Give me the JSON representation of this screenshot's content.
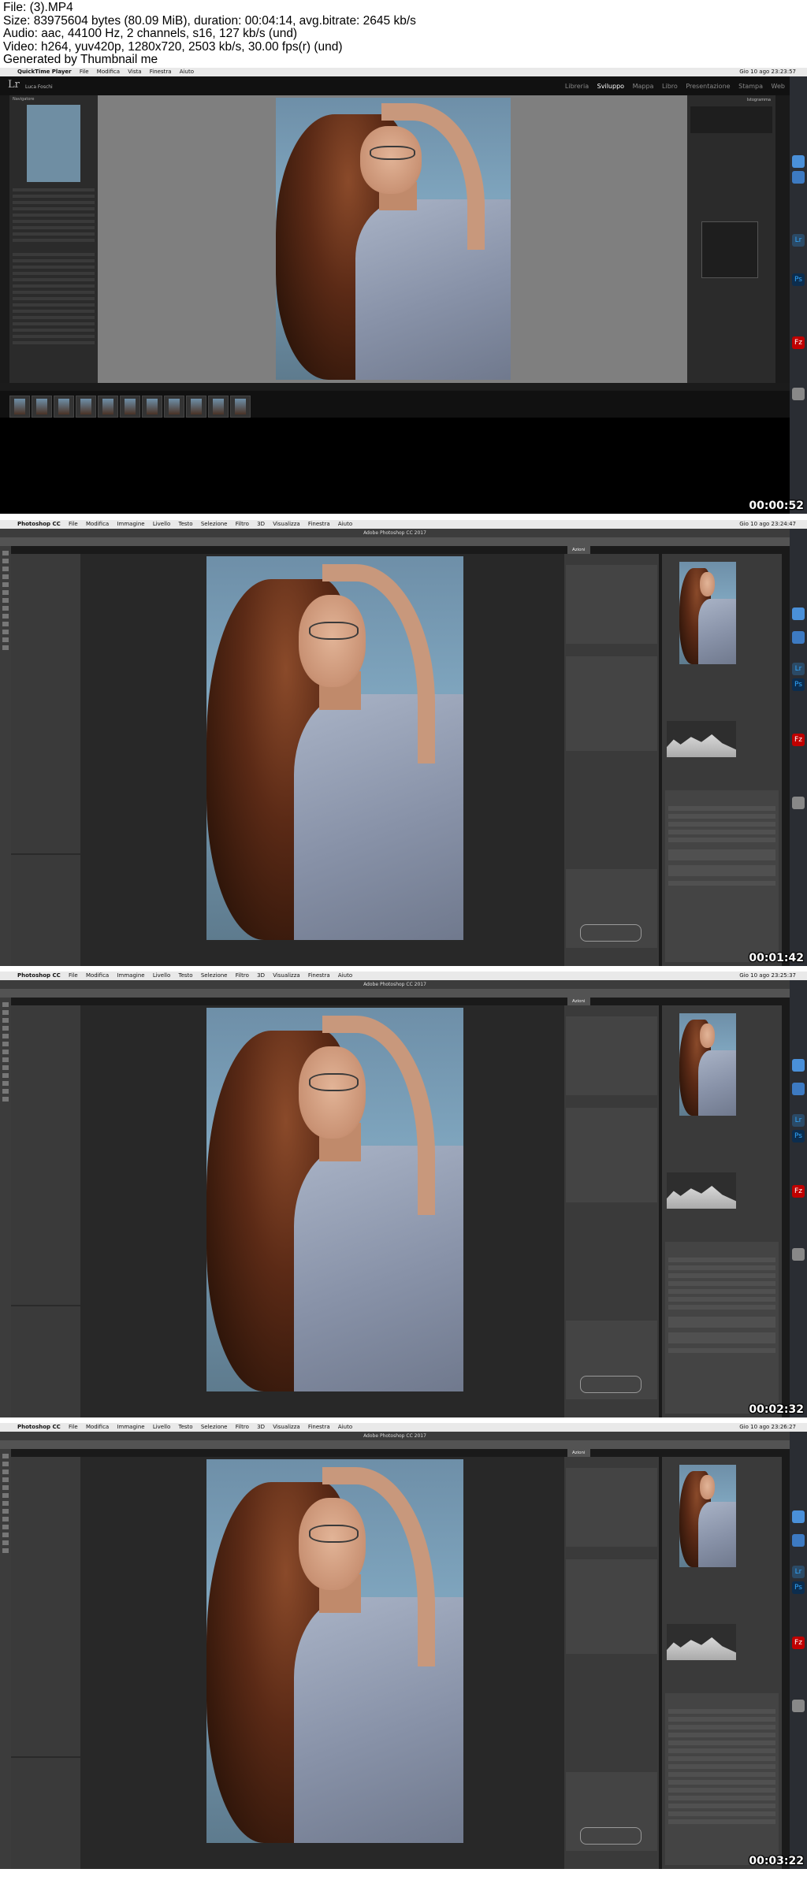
{
  "header": {
    "line1": "File:  (3).MP4",
    "line2": "Size: 83975604 bytes (80.09 MiB), duration: 00:04:14, avg.bitrate: 2645 kb/s",
    "line3": "Audio: aac, 44100 Hz, 2 channels, s16, 127 kb/s (und)",
    "line4": "Video: h264, yuv420p, 1280x720, 2503 kb/s, 30.00 fps(r) (und)",
    "line5": "Generated by Thumbnail me"
  },
  "frames": [
    {
      "app": "QuickTime Player",
      "menu": [
        "File",
        "Modifica",
        "Vista",
        "Finestra",
        "Aiuto"
      ],
      "clock": "Gio 10 ago 23:23:57",
      "timestamp": "00:00:52",
      "lightroom": {
        "logo": "Lr",
        "user": "Luca Foschi",
        "modules": [
          "Libreria",
          "Sviluppo",
          "Mappa",
          "Libro",
          "Presentazione",
          "Stampa",
          "Web"
        ],
        "active_module": "Sviluppo",
        "navigator": "Navigatore",
        "histogram_label": "Istogramma"
      }
    },
    {
      "app": "Photoshop CC",
      "menu": [
        "File",
        "Modifica",
        "Immagine",
        "Livello",
        "Testo",
        "Selezione",
        "Filtro",
        "3D",
        "Visualizza",
        "Finestra",
        "Aiuto"
      ],
      "clock": "Gio 10 ago 23:24:47",
      "window_title": "Adobe Photoshop CC 2017",
      "tab": "Azioni",
      "timestamp": "00:01:42"
    },
    {
      "app": "Photoshop CC",
      "menu": [
        "File",
        "Modifica",
        "Immagine",
        "Livello",
        "Testo",
        "Selezione",
        "Filtro",
        "3D",
        "Visualizza",
        "Finestra",
        "Aiuto"
      ],
      "clock": "Gio 10 ago 23:25:37",
      "window_title": "Adobe Photoshop CC 2017",
      "tab": "Azioni",
      "timestamp": "00:02:32"
    },
    {
      "app": "Photoshop CC",
      "menu": [
        "File",
        "Modifica",
        "Immagine",
        "Livello",
        "Testo",
        "Selezione",
        "Filtro",
        "3D",
        "Visualizza",
        "Finestra",
        "Aiuto"
      ],
      "clock": "Gio 10 ago 23:26:27",
      "window_title": "Adobe Photoshop CC 2017",
      "tab": "Azioni",
      "timestamp": "00:03:22"
    }
  ],
  "dock_icons": [
    "finder-icon",
    "safari-icon",
    "lightroom-icon",
    "photoshop-icon",
    "filezilla-icon",
    "trash-icon"
  ],
  "colors": {
    "lr_bg": "#2b2b2b",
    "ps_bg": "#3a3a3a",
    "dock_bg": "#2a2d33",
    "lr_blue": "#31a8ff",
    "fz_red": "#bf0000"
  }
}
